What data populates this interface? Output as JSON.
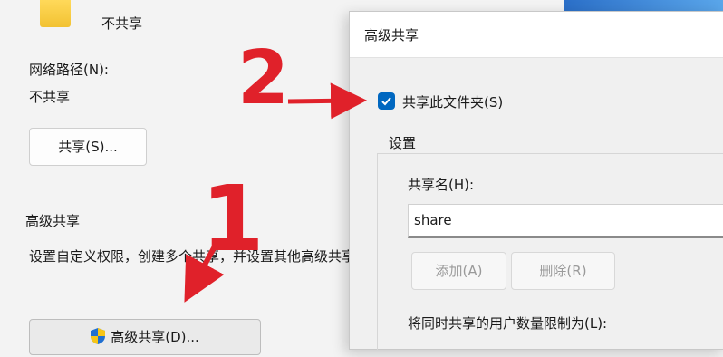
{
  "properties_dialog": {
    "share_status": "不共享",
    "network_path_label": "网络路径(N):",
    "network_path_value": "不共享",
    "share_button": "共享(S)...",
    "advanced_group_title": "高级共享",
    "advanced_description": "设置自定义权限，创建多个共享，并设置其他高级共享选项。",
    "advanced_button": "高级共享(D)..."
  },
  "advanced_dialog": {
    "title": "高级共享",
    "share_checkbox_label": "共享此文件夹(S)",
    "share_checkbox_checked": true,
    "settings_title": "设置",
    "share_name_label": "共享名(H):",
    "share_name_value": "share",
    "add_button": "添加(A)",
    "remove_button": "删除(R)",
    "user_limit_label": "将同时共享的用户数量限制为(L):"
  },
  "annotations": {
    "step1": "1",
    "step2": "2"
  },
  "colors": {
    "accent": "#0067c0",
    "annotation": "#e0212a"
  }
}
